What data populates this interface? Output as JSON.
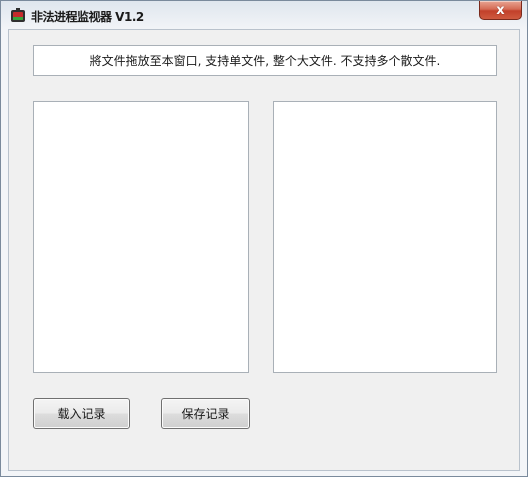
{
  "window": {
    "title": "非法进程监视器 V1.2",
    "close_symbol": "x"
  },
  "notice": {
    "text": "將文件拖放至本窗口, 支持单文件, 整个大文件. 不支持多个散文件."
  },
  "buttons": {
    "load_label": "载入记录",
    "save_label": "保存记录"
  },
  "icons": {
    "app_icon": "app-icon",
    "close_icon": "close-icon"
  }
}
